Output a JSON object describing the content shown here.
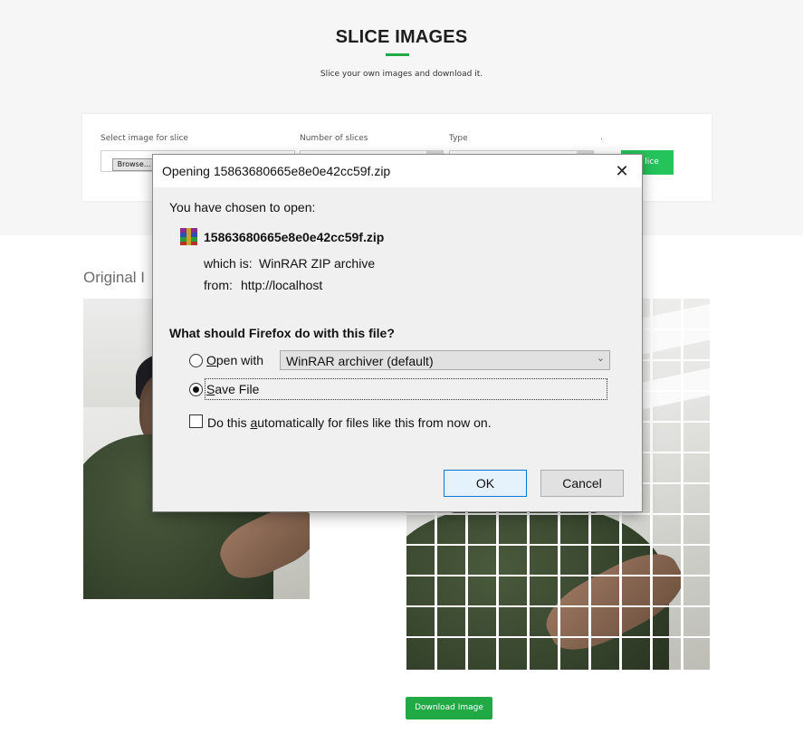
{
  "page": {
    "title": "SLICE IMAGES",
    "subtitle": "Slice your own images and download it.",
    "accent_color": "#21a946",
    "form": {
      "select_image_label": "Select image for slice",
      "browse_label": "Browse...",
      "num_slices_label": "Number of slices",
      "type_label": "Type",
      "dot_mark": ".",
      "slice_button_partial": "lice"
    },
    "original_heading_partial": "Original I",
    "download_button": "Download Image"
  },
  "dialog": {
    "title": "Opening 15863680665e8e0e42cc59f.zip",
    "close_glyph": "✕",
    "chosen_label": "You have chosen to open:",
    "file_name": "15863680665e8e0e42cc59f.zip",
    "which_is_label": "which is:",
    "which_is_value": "WinRAR ZIP archive",
    "from_label": "from:",
    "from_value": "http://localhost",
    "question": "What should Firefox do with this file?",
    "open_with_label": "Open with",
    "open_with_app": "WinRAR archiver (default)",
    "save_file_label": "Save File",
    "selected_option": "save_file",
    "auto_checkbox_label": "Do this automatically for files like this from now on.",
    "auto_checkbox_checked": false,
    "ok_label": "OK",
    "cancel_label": "Cancel",
    "icons": {
      "file_type": "winrar-icon",
      "chevron": "chevron-down-icon",
      "close": "close-icon"
    }
  }
}
